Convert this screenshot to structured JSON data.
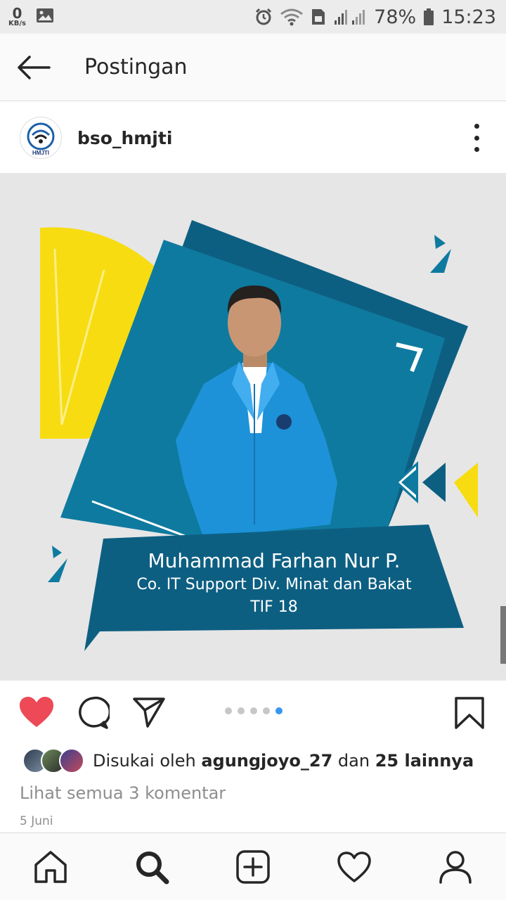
{
  "status_bar": {
    "net_speed": "0",
    "net_unit": "KB/s",
    "battery": "78%",
    "time": "15:23",
    "icons": [
      "image-icon",
      "alarm-icon",
      "wifi-icon",
      "sim-icon",
      "signal-icon",
      "battery-icon"
    ]
  },
  "header": {
    "title": "Postingan"
  },
  "post": {
    "username": "bso_hmjti",
    "avatar_text": "HMJTI",
    "image": {
      "name": "Muhammad Farhan Nur P.",
      "role": "Co. IT Support Div. Minat dan Bakat",
      "year": "TIF 18"
    },
    "carousel": {
      "count": 5,
      "active_index": 4
    },
    "likes": {
      "prefix": "Disukai oleh ",
      "user": "agungjoyo_27",
      "middle": " dan ",
      "others": "25 lainnya"
    },
    "comments_link": "Lihat semua 3 komentar",
    "date": "5 Juni"
  },
  "colors": {
    "like_red": "#ed4956",
    "carousel_active": "#3897f0",
    "teal_dark": "#0d5f82",
    "teal": "#0f7a9f",
    "yellow": "#f7dc12"
  },
  "bottom_nav": [
    "home-icon",
    "search-icon",
    "add-icon",
    "activity-icon",
    "profile-icon"
  ]
}
